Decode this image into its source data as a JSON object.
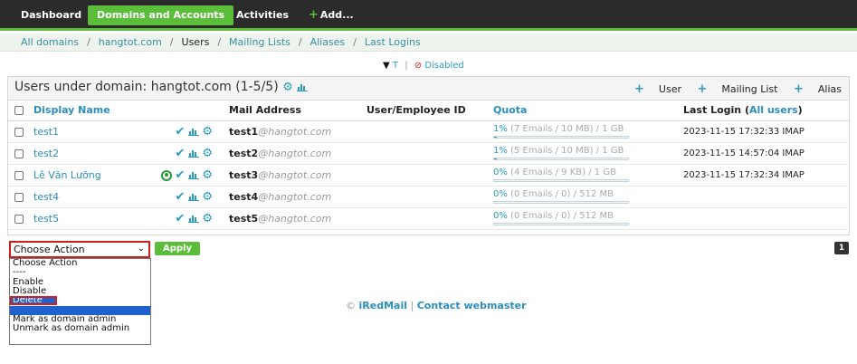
{
  "nav": {
    "dashboard": "Dashboard",
    "domains": "Domains and Accounts",
    "activities": "Activities",
    "add": "Add..."
  },
  "breadcrumb": {
    "all_domains": "All domains",
    "domain": "hangtot.com",
    "users": "Users",
    "mailing_lists": "Mailing Lists",
    "aliases": "Aliases",
    "last_logins": "Last Logins"
  },
  "filter": {
    "t": "T",
    "disabled": "Disabled"
  },
  "panel": {
    "title": "Users under domain: hangtot.com (1-5/5)",
    "actions": {
      "user": "User",
      "mailing_list": "Mailing List",
      "alias": "Alias"
    }
  },
  "table": {
    "columns": [
      "Display Name",
      "Mail Address",
      "User/Employee ID",
      "Quota",
      "Last Login"
    ],
    "last_login_link": "All users",
    "rows": [
      {
        "name": "test1",
        "admin": false,
        "mail_user": "test1",
        "mail_domain": "@hangtot.com",
        "quota_pct": "1%",
        "quota_detail": "(7 Emails / 10 MB) / 1 GB",
        "quota_fill": 0.01,
        "last_login": "2023-11-15 17:32:33 IMAP"
      },
      {
        "name": "test2",
        "admin": false,
        "mail_user": "test2",
        "mail_domain": "@hangtot.com",
        "quota_pct": "1%",
        "quota_detail": "(5 Emails / 10 MB) / 1 GB",
        "quota_fill": 0.01,
        "last_login": "2023-11-15 14:57:04 IMAP"
      },
      {
        "name": "Lê Văn Lưỡng",
        "admin": true,
        "mail_user": "test3",
        "mail_domain": "@hangtot.com",
        "quota_pct": "0%",
        "quota_detail": "(4 Emails / 9 KB) / 1 GB",
        "quota_fill": 0.0,
        "last_login": "2023-11-15 17:32:34 IMAP"
      },
      {
        "name": "test4",
        "admin": false,
        "mail_user": "test4",
        "mail_domain": "@hangtot.com",
        "quota_pct": "0%",
        "quota_detail": "(0 Emails / 0) / 512 MB",
        "quota_fill": 0.0,
        "last_login": ""
      },
      {
        "name": "test5",
        "admin": false,
        "mail_user": "test5",
        "mail_domain": "@hangtot.com",
        "quota_pct": "0%",
        "quota_detail": "(0 Emails / 0) / 512 MB",
        "quota_fill": 0.0,
        "last_login": ""
      }
    ]
  },
  "action_select": {
    "value": "Choose Action",
    "options": [
      "Choose Action",
      "----",
      "Enable",
      "Disable",
      "Delete",
      "----",
      "Mark as domain admin",
      "Unmark as domain admin"
    ],
    "highlighted": "Delete"
  },
  "apply_label": "Apply",
  "pager": "1",
  "footer": {
    "brand": "iRedMail",
    "contact": "Contact webmaster",
    "sep": "|"
  },
  "colors": {
    "accent": "#5bbd3a",
    "link": "#2a8fbf",
    "highlight": "#cc1f1f"
  }
}
